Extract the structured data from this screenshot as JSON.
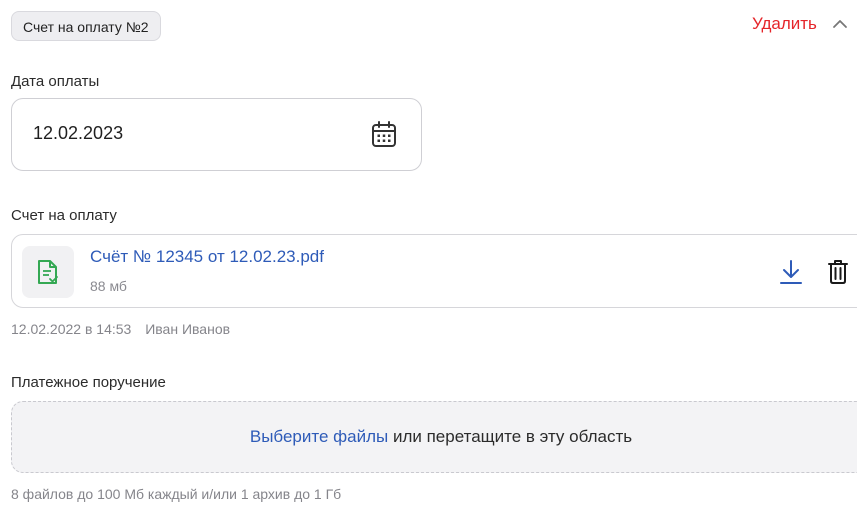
{
  "header": {
    "badge": "Счет на оплату №2",
    "delete_label": "Удалить",
    "collapse_icon": "chevron-up-icon"
  },
  "payment_date": {
    "label": "Дата оплаты",
    "value": "12.02.2023",
    "icon": "calendar-icon"
  },
  "invoice": {
    "label": "Счет на оплату",
    "file": {
      "name": "Счёт № 12345 от 12.02.23.pdf",
      "size": "88 мб",
      "icon": "file-check-icon",
      "download_icon": "download-icon",
      "delete_icon": "trash-icon"
    },
    "uploaded_at": "12.02.2022 в 14:53",
    "uploaded_by": "Иван Иванов"
  },
  "payment_order": {
    "label": "Платежное поручение",
    "dropzone_link": "Выберите файлы",
    "dropzone_text": " или перетащите в эту область",
    "hint": "8 файлов до 100 Мб каждый и/или 1 архив до 1 Гб"
  },
  "colors": {
    "link": "#2e5bb8",
    "danger": "#e5252a",
    "file_icon": "#34a853"
  }
}
